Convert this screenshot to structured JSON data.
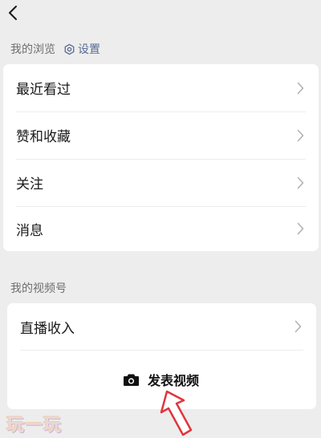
{
  "nav": {
    "back_icon": "chevron-left-icon"
  },
  "browse": {
    "label": "我的浏览",
    "settings_label": "设置",
    "settings_icon": "gear-icon",
    "items": [
      {
        "label": "最近看过"
      },
      {
        "label": "赞和收藏"
      },
      {
        "label": "关注"
      },
      {
        "label": "消息"
      }
    ]
  },
  "channels": {
    "label": "我的视频号",
    "items": [
      {
        "label": "直播收入"
      }
    ],
    "publish_label": "发表视频",
    "publish_icon": "camera-icon"
  },
  "watermark": {
    "text": "玩一玩"
  },
  "colors": {
    "background": "#ededed",
    "card": "#ffffff",
    "link": "#576b95",
    "arrow": "#e0353d"
  }
}
